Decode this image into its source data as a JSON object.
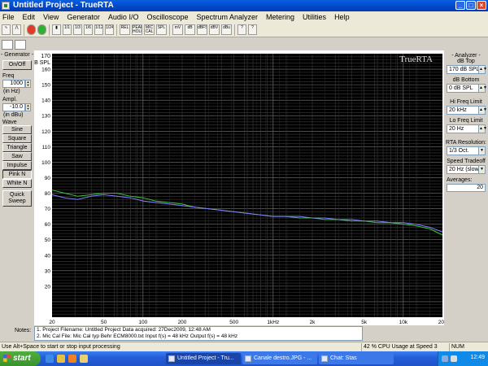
{
  "window": {
    "title": "Untitled Project - TrueRTA"
  },
  "menu": [
    "File",
    "Edit",
    "View",
    "Generator",
    "Audio I/O",
    "Oscilloscope",
    "Spectrum Analyzer",
    "Metering",
    "Utilities",
    "Help"
  ],
  "toolbar": {
    "buttons": [
      "1/1",
      "1/3",
      "1/6",
      "1/12",
      "1/24",
      "REL",
      "PEAK HOLD",
      "MIC CAL",
      "SPL",
      "mV",
      "dB",
      "dBFS",
      "dBV",
      "dBu",
      "?",
      "?"
    ]
  },
  "generator": {
    "header": "- Generator -",
    "onoff_label": "On/Off",
    "freq_label": "Freq",
    "freq_value": "1000",
    "freq_units": "(in Hz)",
    "ampl_label": "Ampl.",
    "ampl_value": "-10.0",
    "ampl_units": "(in dBu)",
    "wave_label": "Wave",
    "waves": [
      "Sine",
      "Square",
      "Triangle",
      "Saw",
      "Impulse",
      "Pink N",
      "White N"
    ],
    "quick_sweep_label": "Quick Sweep"
  },
  "analyzer": {
    "header": "- Analyzer -",
    "db_top_label": "dB Top",
    "db_top_value": "170 dB SPL",
    "db_bottom_label": "dB Bottom",
    "db_bottom_value": "0 dB SPL",
    "hi_freq_label": "Hi Freq Limit",
    "hi_freq_value": "20 kHz",
    "lo_freq_label": "Lo Freq Limit",
    "lo_freq_value": "20 Hz",
    "rta_res_label": "RTA Resolution:",
    "rta_res_value": "1/3 Oct.",
    "speed_label": "Speed Tradeoff",
    "speed_value": "20 Hz (slow)",
    "averages_label": "Averages:",
    "averages_value": "20"
  },
  "chart_data": {
    "type": "line",
    "title": "",
    "watermark": "TrueRTA",
    "ylabel": "dB SPL",
    "xscale": "log",
    "xlim": [
      20,
      20000
    ],
    "ylim": [
      0,
      170
    ],
    "ytick_values": [
      20,
      30,
      40,
      50,
      60,
      70,
      80,
      90,
      100,
      110,
      120,
      130,
      140,
      150,
      160
    ],
    "ytick_labels": [
      "20",
      "30",
      "40",
      "50",
      "60",
      "70",
      "80",
      "90",
      "100",
      "110",
      "120",
      "130",
      "140",
      "150",
      "160"
    ],
    "xtick_values": [
      20,
      50,
      100,
      200,
      500,
      1000,
      2000,
      5000,
      10000,
      20000
    ],
    "xtick_labels": [
      "20",
      "50",
      "100",
      "200",
      "500",
      "1kHz",
      "2k",
      "5k",
      "10k",
      "20k"
    ],
    "ycorner_label": "170\ndB SPL",
    "grid": true,
    "background": "#000000",
    "series": [
      {
        "color": "#40c040",
        "x": [
          20,
          25,
          31.5,
          40,
          50,
          63,
          80,
          100,
          125,
          160,
          200,
          250,
          315,
          400,
          500,
          630,
          800,
          1000,
          1250,
          1600,
          2000,
          2500,
          3150,
          4000,
          5000,
          6300,
          8000,
          10000,
          12500,
          16000,
          20000
        ],
        "y": [
          82,
          80,
          78,
          79,
          80,
          80,
          78,
          77,
          75,
          74,
          73,
          71,
          70,
          69,
          68,
          67,
          66,
          65,
          65,
          64,
          64,
          63,
          63,
          62,
          62,
          61,
          61,
          60,
          59,
          57,
          53
        ]
      },
      {
        "color": "#8080ff",
        "x": [
          20,
          25,
          31.5,
          40,
          50,
          63,
          80,
          100,
          125,
          160,
          200,
          250,
          315,
          400,
          500,
          630,
          800,
          1000,
          1250,
          1600,
          2000,
          2500,
          3150,
          4000,
          5000,
          6300,
          8000,
          10000,
          12500,
          16000,
          20000
        ],
        "y": [
          79,
          77,
          76,
          78,
          79,
          78,
          77,
          75,
          74,
          73,
          72,
          71,
          70,
          69,
          68,
          67,
          66,
          65,
          65,
          65,
          64,
          64,
          63,
          63,
          62,
          62,
          61,
          61,
          60,
          58,
          55
        ]
      }
    ]
  },
  "notes": {
    "label": "Notes:",
    "line1": "1. Project Filename: Untitled Project      Data acquired: 27Dec2009, 12:48 AM",
    "line2": "2. Mic Cal File: Mic Cal typ Behr ECM8000.txt      Input f(s) = 48 kHz   Output f(s) = 48 kHz"
  },
  "status": {
    "hint": "Use Alt+Space to start or stop input processing",
    "cpu": "42 % CPU Usage at Speed 3",
    "num": "NUM"
  },
  "taskbar": {
    "start_label": "start",
    "tasks": [
      "Untitled Project - Tru...",
      "Canale destro.JPG - ...",
      "Chat: Stas"
    ],
    "clock": "12:49"
  }
}
